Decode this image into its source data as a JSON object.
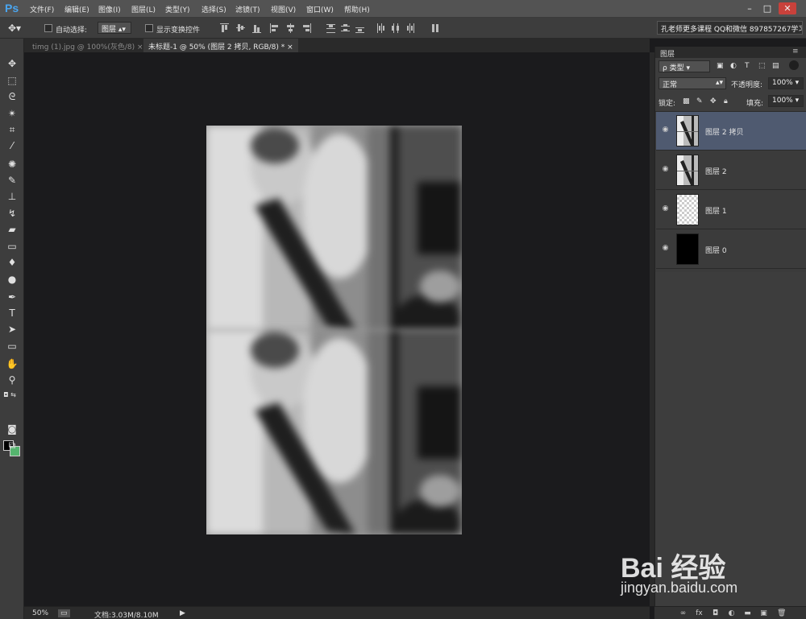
{
  "app": {
    "logo": "Ps"
  },
  "menu": [
    "文件(F)",
    "编辑(E)",
    "图像(I)",
    "图层(L)",
    "类型(Y)",
    "选择(S)",
    "滤镜(T)",
    "视图(V)",
    "窗口(W)",
    "帮助(H)"
  ],
  "window_controls": {
    "minimize": "–",
    "maximize": "□",
    "close": "✕"
  },
  "options_bar": {
    "auto_select_label": "自动选择:",
    "auto_select_value": "图层",
    "show_transform_label": "显示变换控件",
    "workspace": "孔老师更多课程 QQ和微信 897857267学习"
  },
  "tabs": [
    {
      "label": "timg (1).jpg @ 100%(灰色/8)",
      "close": "×"
    },
    {
      "label": "未标题-1 @ 50% (图层 2 拷贝, RGB/8) *",
      "close": "×"
    }
  ],
  "status": {
    "zoom": "50%",
    "doc_info": "文档:3.03M/8.10M"
  },
  "layers_panel": {
    "title": "图层",
    "filter_label": "ρ 类型",
    "blend_mode": "正常",
    "opacity_label": "不透明度:",
    "opacity_value": "100%",
    "lock_label": "锁定:",
    "fill_label": "填充:",
    "fill_value": "100%",
    "layers": [
      {
        "name": "图层 2 拷贝",
        "selected": true,
        "thumb": "photo"
      },
      {
        "name": "图层 2",
        "selected": false,
        "thumb": "photo"
      },
      {
        "name": "图层 1",
        "selected": false,
        "thumb": "transparent"
      },
      {
        "name": "图层 0",
        "selected": false,
        "thumb": "black"
      }
    ]
  },
  "watermark": {
    "brand": "Bai  经验",
    "url": "jingyan.baidu.com"
  }
}
